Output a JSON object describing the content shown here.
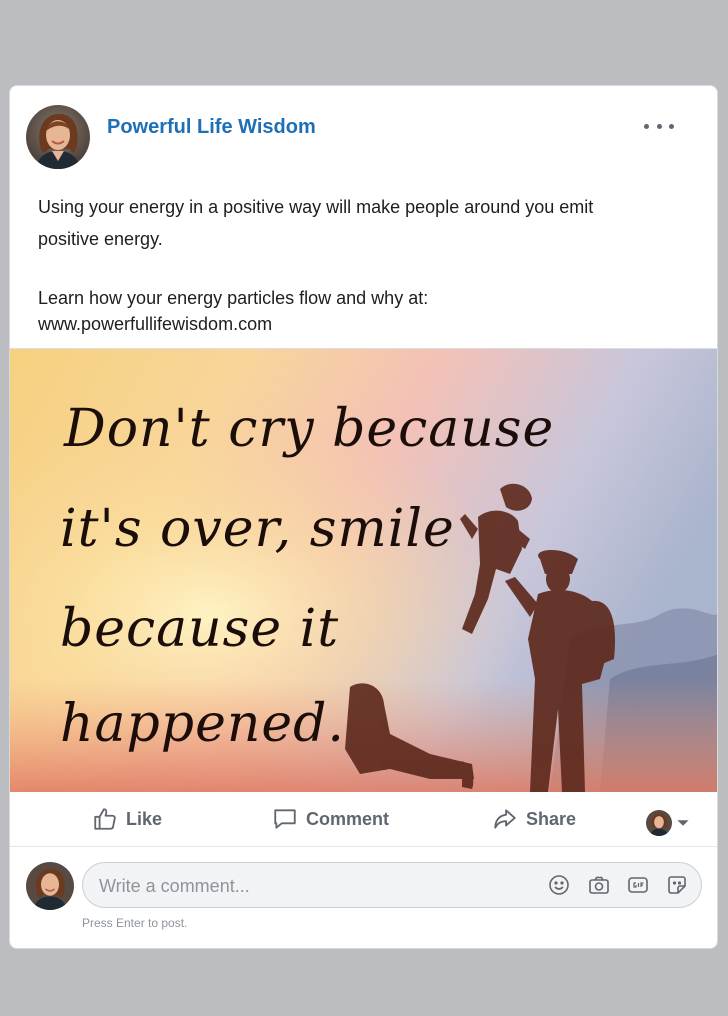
{
  "post": {
    "page_name": "Powerful Life Wisdom",
    "text_line_1": "Using your energy in a positive way will make people around you emit",
    "text_line_2": "positive energy.",
    "text_line_3": "Learn how your energy particles flow and why at:",
    "text_line_4": "www.powerfullifewisdom.com"
  },
  "image": {
    "quote_lines": [
      "Don't cry because",
      "it's over, smile",
      "because it",
      "happened."
    ]
  },
  "actions": {
    "like_label": "Like",
    "comment_label": "Comment",
    "share_label": "Share"
  },
  "composer": {
    "placeholder": "Write a comment...",
    "hint": "Press Enter to post."
  },
  "icons": {
    "more": "more-options-icon",
    "like": "thumbs-up-icon",
    "comment": "speech-bubble-icon",
    "share": "share-arrow-icon",
    "emoji": "emoji-icon",
    "camera": "camera-icon",
    "gif": "gif-icon",
    "sticker": "sticker-icon"
  },
  "colors": {
    "page_name": "#1f6fb6",
    "action_text": "#606770",
    "background": "#bcbdc1"
  }
}
